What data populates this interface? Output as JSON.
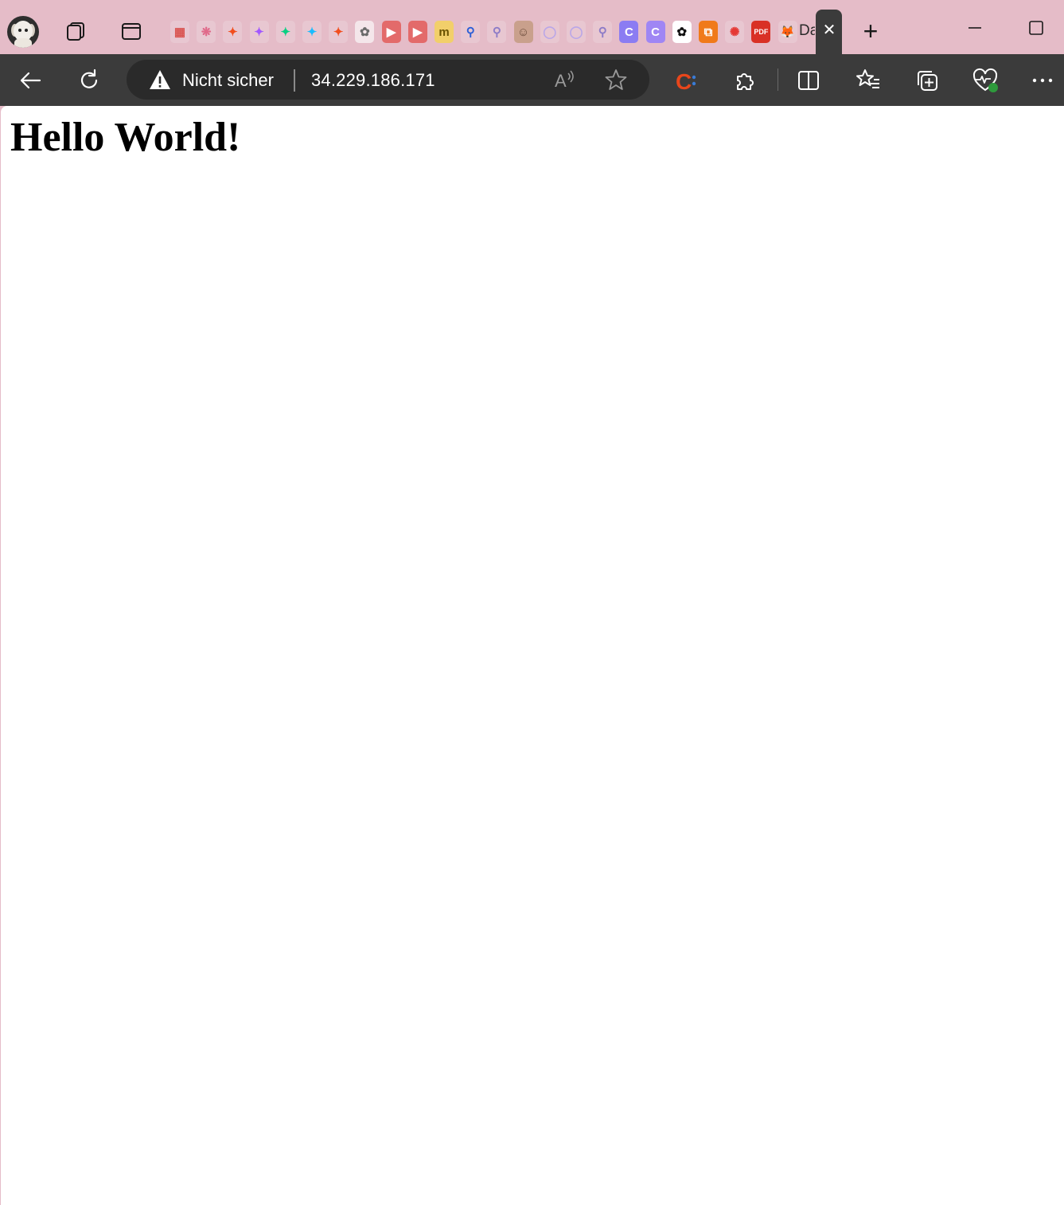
{
  "tabstrip": {
    "active_tab_title": "Da",
    "pinned_tabs": [
      {
        "icon": "microsoft-tiles-icon",
        "glyph": "▦",
        "color": "#d9534f",
        "bg": "#e8c7d1"
      },
      {
        "icon": "dotted-circle-icon",
        "glyph": "❋",
        "color": "#e06a8a",
        "bg": "#e8c7d1"
      },
      {
        "icon": "figma-icon",
        "glyph": "✦",
        "color": "#f24e1e",
        "bg": "#e8c7d1"
      },
      {
        "icon": "figma-icon",
        "glyph": "✦",
        "color": "#a259ff",
        "bg": "#e8c7d1"
      },
      {
        "icon": "figma-icon",
        "glyph": "✦",
        "color": "#0acf83",
        "bg": "#e8c7d1"
      },
      {
        "icon": "figma-icon",
        "glyph": "✦",
        "color": "#1abcfe",
        "bg": "#e8c7d1"
      },
      {
        "icon": "figma-icon",
        "glyph": "✦",
        "color": "#f24e1e",
        "bg": "#e8c7d1"
      },
      {
        "icon": "openai-icon",
        "glyph": "✿",
        "color": "#6b6b6b",
        "bg": "#f4e6ea"
      },
      {
        "icon": "youtube-icon",
        "glyph": "▶",
        "color": "#ffffff",
        "bg": "#e36a6a"
      },
      {
        "icon": "youtube-icon",
        "glyph": "▶",
        "color": "#ffffff",
        "bg": "#e36a6a"
      },
      {
        "icon": "miro-icon",
        "glyph": "m",
        "color": "#6a5200",
        "bg": "#f2cf6a"
      },
      {
        "icon": "search-icon",
        "glyph": "⚲",
        "color": "#2c5fd6",
        "bg": "#e8c7d1"
      },
      {
        "icon": "search-icon",
        "glyph": "⚲",
        "color": "#8d7cc7",
        "bg": "#e8c7d1"
      },
      {
        "icon": "profile-photo-icon",
        "glyph": "☺",
        "color": "#6b4c3b",
        "bg": "#c9a08c"
      },
      {
        "icon": "clock-icon",
        "glyph": "◯",
        "color": "#b9a6e8",
        "bg": "#e8c7d1"
      },
      {
        "icon": "clock-icon",
        "glyph": "◯",
        "color": "#b9a6e8",
        "bg": "#e8c7d1"
      },
      {
        "icon": "search-icon",
        "glyph": "⚲",
        "color": "#8d7cc7",
        "bg": "#e8c7d1"
      },
      {
        "icon": "canva-icon",
        "glyph": "C",
        "color": "#ffffff",
        "bg": "#8b7cf2"
      },
      {
        "icon": "canva-icon",
        "glyph": "C",
        "color": "#ffffff",
        "bg": "#9f86f4"
      },
      {
        "icon": "openai-icon",
        "glyph": "✿",
        "color": "#111111",
        "bg": "#ffffff"
      },
      {
        "icon": "overlapping-squares-icon",
        "glyph": "⧉",
        "color": "#ffffff",
        "bg": "#f07a1a"
      },
      {
        "icon": "red-star-icon",
        "glyph": "✺",
        "color": "#e53935",
        "bg": "#e8c7d1"
      },
      {
        "icon": "pdf-icon",
        "glyph": "PDF",
        "color": "#ffffff",
        "bg": "#d93025"
      },
      {
        "icon": "gitlab-icon",
        "glyph": "🦊",
        "color": "#fc6d26",
        "bg": "#e8c7d1"
      }
    ],
    "new_tab_label": "+"
  },
  "toolbar": {
    "security_label": "Nicht sicher",
    "url": "34.229.186.171",
    "read_aloud_icon": "read-aloud-icon",
    "favorite_icon": "star-icon"
  },
  "page": {
    "heading": "Hello World!"
  }
}
